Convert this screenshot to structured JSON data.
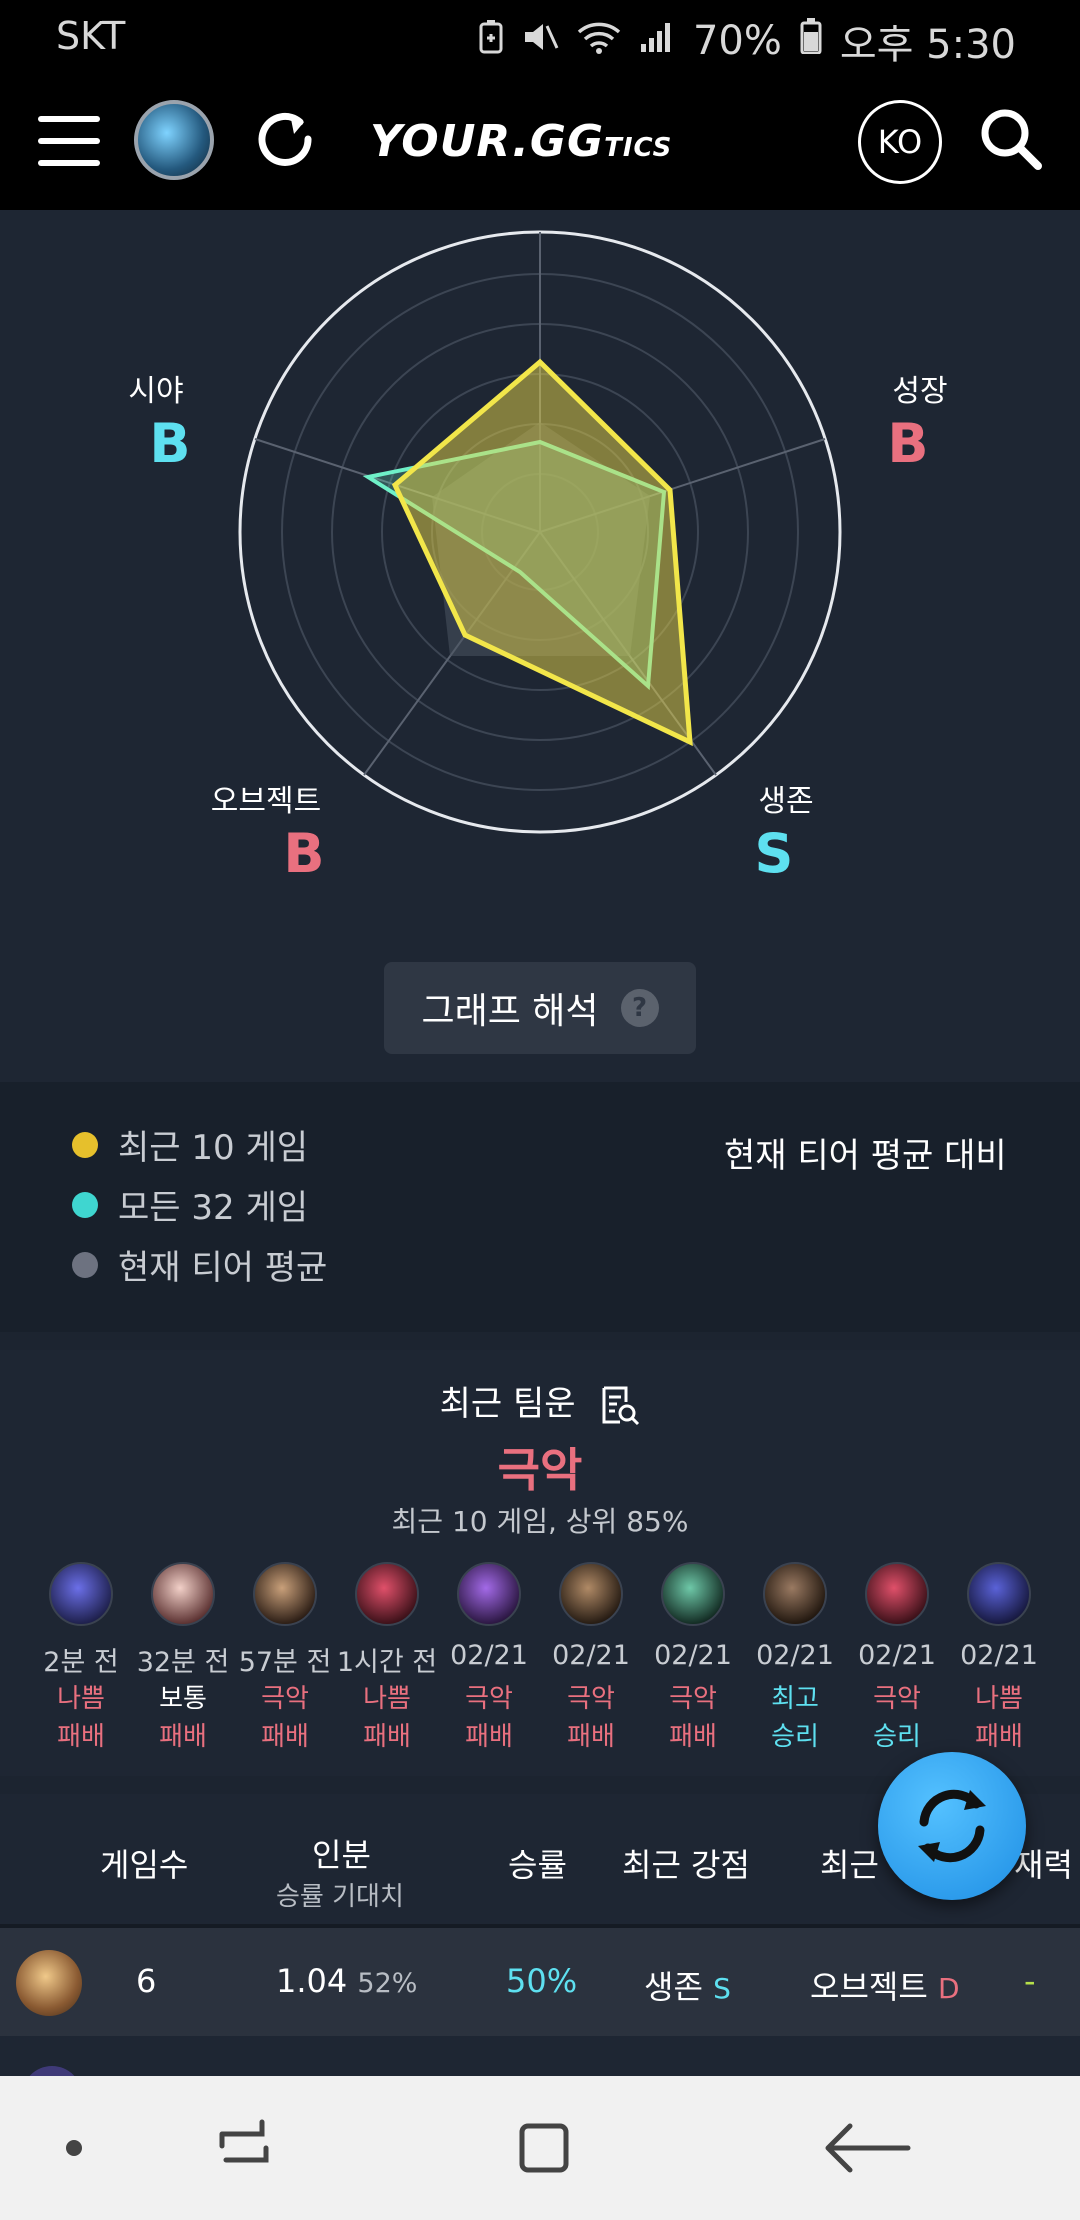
{
  "status_bar": {
    "carrier": "SKT",
    "battery": "70%",
    "time": "오후 5:30"
  },
  "app_bar": {
    "logo_main": "YOUR.GG",
    "logo_suffix": "TICS",
    "language": "KO"
  },
  "radar": {
    "axes": [
      {
        "name": "성장",
        "grade": "B",
        "grade_color": "#e9707f"
      },
      {
        "name": "생존",
        "grade": "S",
        "grade_color": "#5ee0f0"
      },
      {
        "name": "오브젝트",
        "grade": "B",
        "grade_color": "#e9707f"
      },
      {
        "name": "시야",
        "grade": "B",
        "grade_color": "#5ee0f0"
      }
    ],
    "series_colors": {
      "recent": "#f2e64a",
      "all": "#6ff0c8",
      "tier": "#6b7280"
    },
    "interpret_button": "그래프 해석",
    "help_glyph": "?"
  },
  "legend": {
    "items": [
      {
        "label": "최근 10 게임",
        "color": "#e6c02c"
      },
      {
        "label": "모든 32 게임",
        "color": "#3fd6d0"
      },
      {
        "label": "현재 티어 평균",
        "color": "#6d7280"
      }
    ],
    "compare_label": "현재 티어 평균 대비"
  },
  "team_luck": {
    "title": "최근 팀운",
    "grade": "극악",
    "subtitle": "최근 10 게임, 상위 85%",
    "games": [
      {
        "time": "2분 전",
        "luck": "나쁨",
        "luck_color": "#e9707f",
        "result": "패배",
        "result_color": "#e9707f"
      },
      {
        "time": "32분 전",
        "luck": "보통",
        "luck_color": "#ffffff",
        "result": "패배",
        "result_color": "#e9707f"
      },
      {
        "time": "57분 전",
        "luck": "극악",
        "luck_color": "#e9707f",
        "result": "패배",
        "result_color": "#e9707f"
      },
      {
        "time": "1시간 전",
        "luck": "나쁨",
        "luck_color": "#e9707f",
        "result": "패배",
        "result_color": "#e9707f"
      },
      {
        "time": "02/21",
        "luck": "극악",
        "luck_color": "#e9707f",
        "result": "패배",
        "result_color": "#e9707f"
      },
      {
        "time": "02/21",
        "luck": "극악",
        "luck_color": "#e9707f",
        "result": "패배",
        "result_color": "#e9707f"
      },
      {
        "time": "02/21",
        "luck": "극악",
        "luck_color": "#e9707f",
        "result": "패배",
        "result_color": "#e9707f"
      },
      {
        "time": "02/21",
        "luck": "최고",
        "luck_color": "#5ee0f0",
        "result": "승리",
        "result_color": "#5ee0f0"
      },
      {
        "time": "02/21",
        "luck": "극악",
        "luck_color": "#e9707f",
        "result": "승리",
        "result_color": "#5ee0f0"
      },
      {
        "time": "02/21",
        "luck": "나쁨",
        "luck_color": "#e9707f",
        "result": "패배",
        "result_color": "#e9707f"
      }
    ]
  },
  "table": {
    "headers": {
      "games": "게임수",
      "per_person": "인분",
      "per_person_sub": "승률 기대치",
      "winrate": "승률",
      "strength": "최근 강점",
      "weakness": "최근",
      "last": "재력"
    },
    "row": {
      "games": "6",
      "per_person": "1.04",
      "expected_winrate": "52%",
      "winrate": "50%",
      "strength": "생존",
      "strength_grade": "S",
      "weakness": "오브젝트",
      "weakness_grade": "D",
      "last": "-"
    }
  }
}
